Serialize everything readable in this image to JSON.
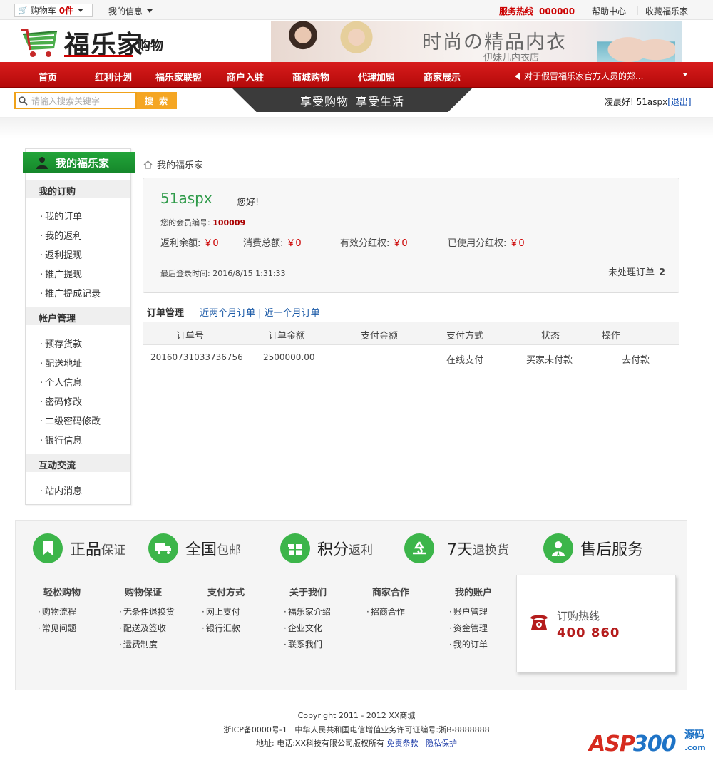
{
  "topbar": {
    "cart_label": "购物车",
    "cart_count": "0件",
    "my_info": "我的信息",
    "hotline_label": "服务热线",
    "hotline_number": "000000",
    "help": "帮助中心",
    "favorite": "收藏福乐家"
  },
  "header": {
    "logo_text": "福乐家",
    "logo_sub": "购物",
    "banner_title": "时尚の精品内衣",
    "banner_sub": "伊妹儿内衣店"
  },
  "nav": {
    "items": [
      "首页",
      "红利计划",
      "福乐家联盟",
      "商户入驻",
      "商城购物",
      "代理加盟",
      "商家展示"
    ],
    "notice": "对于假冒福乐家官方人员的郑..."
  },
  "search": {
    "placeholder": "请输入搜索关键字",
    "button": "搜 索"
  },
  "slogan": [
    "享受购物",
    "享受生活"
  ],
  "greeting": {
    "text": "凌晨好! 51aspx",
    "logout": "[退出]"
  },
  "sidebar": {
    "title": "我的福乐家",
    "sections": [
      {
        "title": "我的订购",
        "items": [
          "我的订单",
          "我的返利",
          "返利提现",
          "推广提现",
          "推广提成记录"
        ]
      },
      {
        "title": "帐户管理",
        "items": [
          "预存货款",
          "配送地址",
          "个人信息",
          "密码修改",
          "二级密码修改",
          "银行信息"
        ]
      },
      {
        "title": "互动交流",
        "items": [
          "站内消息"
        ]
      }
    ]
  },
  "breadcrumb": "我的福乐家",
  "account": {
    "username": "51aspx",
    "hello": "您好!",
    "member_label": "您的会员编号:",
    "member_no": "100009",
    "stats": [
      {
        "label": "返利余额:",
        "value": "￥0"
      },
      {
        "label": "消费总额:",
        "value": "￥0"
      },
      {
        "label": "有效分红权:",
        "value": "￥0"
      },
      {
        "label": "已使用分红权:",
        "value": "￥0"
      }
    ],
    "last_login_label": "最后登录时间:",
    "last_login": "2016/8/15 1:31:33",
    "pending_label": "未处理订单",
    "pending_count": "2"
  },
  "orders": {
    "tab_title": "订单管理",
    "tab_two_months": "近两个月订单",
    "tab_one_month": "近一个月订单",
    "columns": [
      "订单号",
      "订单金额",
      "支付金额",
      "支付方式",
      "状态",
      "操作"
    ],
    "rows": [
      {
        "id": "20160731033736756",
        "amount": "2500000.00",
        "paid": "",
        "method": "在线支付",
        "status": "买家未付款",
        "action": "去付款"
      }
    ]
  },
  "footer": {
    "features": [
      {
        "big": "正品",
        "small": "保证",
        "icon": "bookmark-icon"
      },
      {
        "big": "全国",
        "small": "包邮",
        "icon": "truck-icon"
      },
      {
        "big": "积分",
        "small": "返利",
        "icon": "gift-icon"
      },
      {
        "big": "7天",
        "small": "退换货",
        "icon": "recycle-icon"
      },
      {
        "big": "售后服务",
        "small": "",
        "icon": "service-icon"
      }
    ],
    "columns": [
      {
        "title": "轻松购物",
        "links": [
          "购物流程",
          "常见问题"
        ]
      },
      {
        "title": "购物保证",
        "links": [
          "无条件退换货",
          "配送及签收",
          "运费制度"
        ]
      },
      {
        "title": "支付方式",
        "links": [
          "网上支付",
          "银行汇款"
        ]
      },
      {
        "title": "关于我们",
        "links": [
          "福乐家介绍",
          "企业文化",
          "联系我们"
        ]
      },
      {
        "title": "商家合作",
        "links": [
          "招商合作"
        ]
      },
      {
        "title": "我的账户",
        "links": [
          "账户管理",
          "资金管理",
          "我的订单"
        ]
      }
    ],
    "hotline_label": "订购热线",
    "hotline_number": "400 860"
  },
  "copyright": {
    "line1": "Copyright 2011 - 2012 XX商城",
    "line2": "浙ICP备0000号-1   中华人民共和国电信增值业务许可证编号:浙B-8888888",
    "line3_prefix": "地址:  电话:XX科技有限公司版权所有",
    "terms": "免责条款",
    "privacy": "隐私保护"
  },
  "watermark": {
    "brand_a": "ASP",
    "brand_b": "300",
    "tag": "源码",
    "domain": ".com"
  },
  "colors": {
    "brand_red": "#c00000",
    "side_green": "#1a952f",
    "search_orange": "#f5a623",
    "feature_green": "#3cb54a"
  }
}
